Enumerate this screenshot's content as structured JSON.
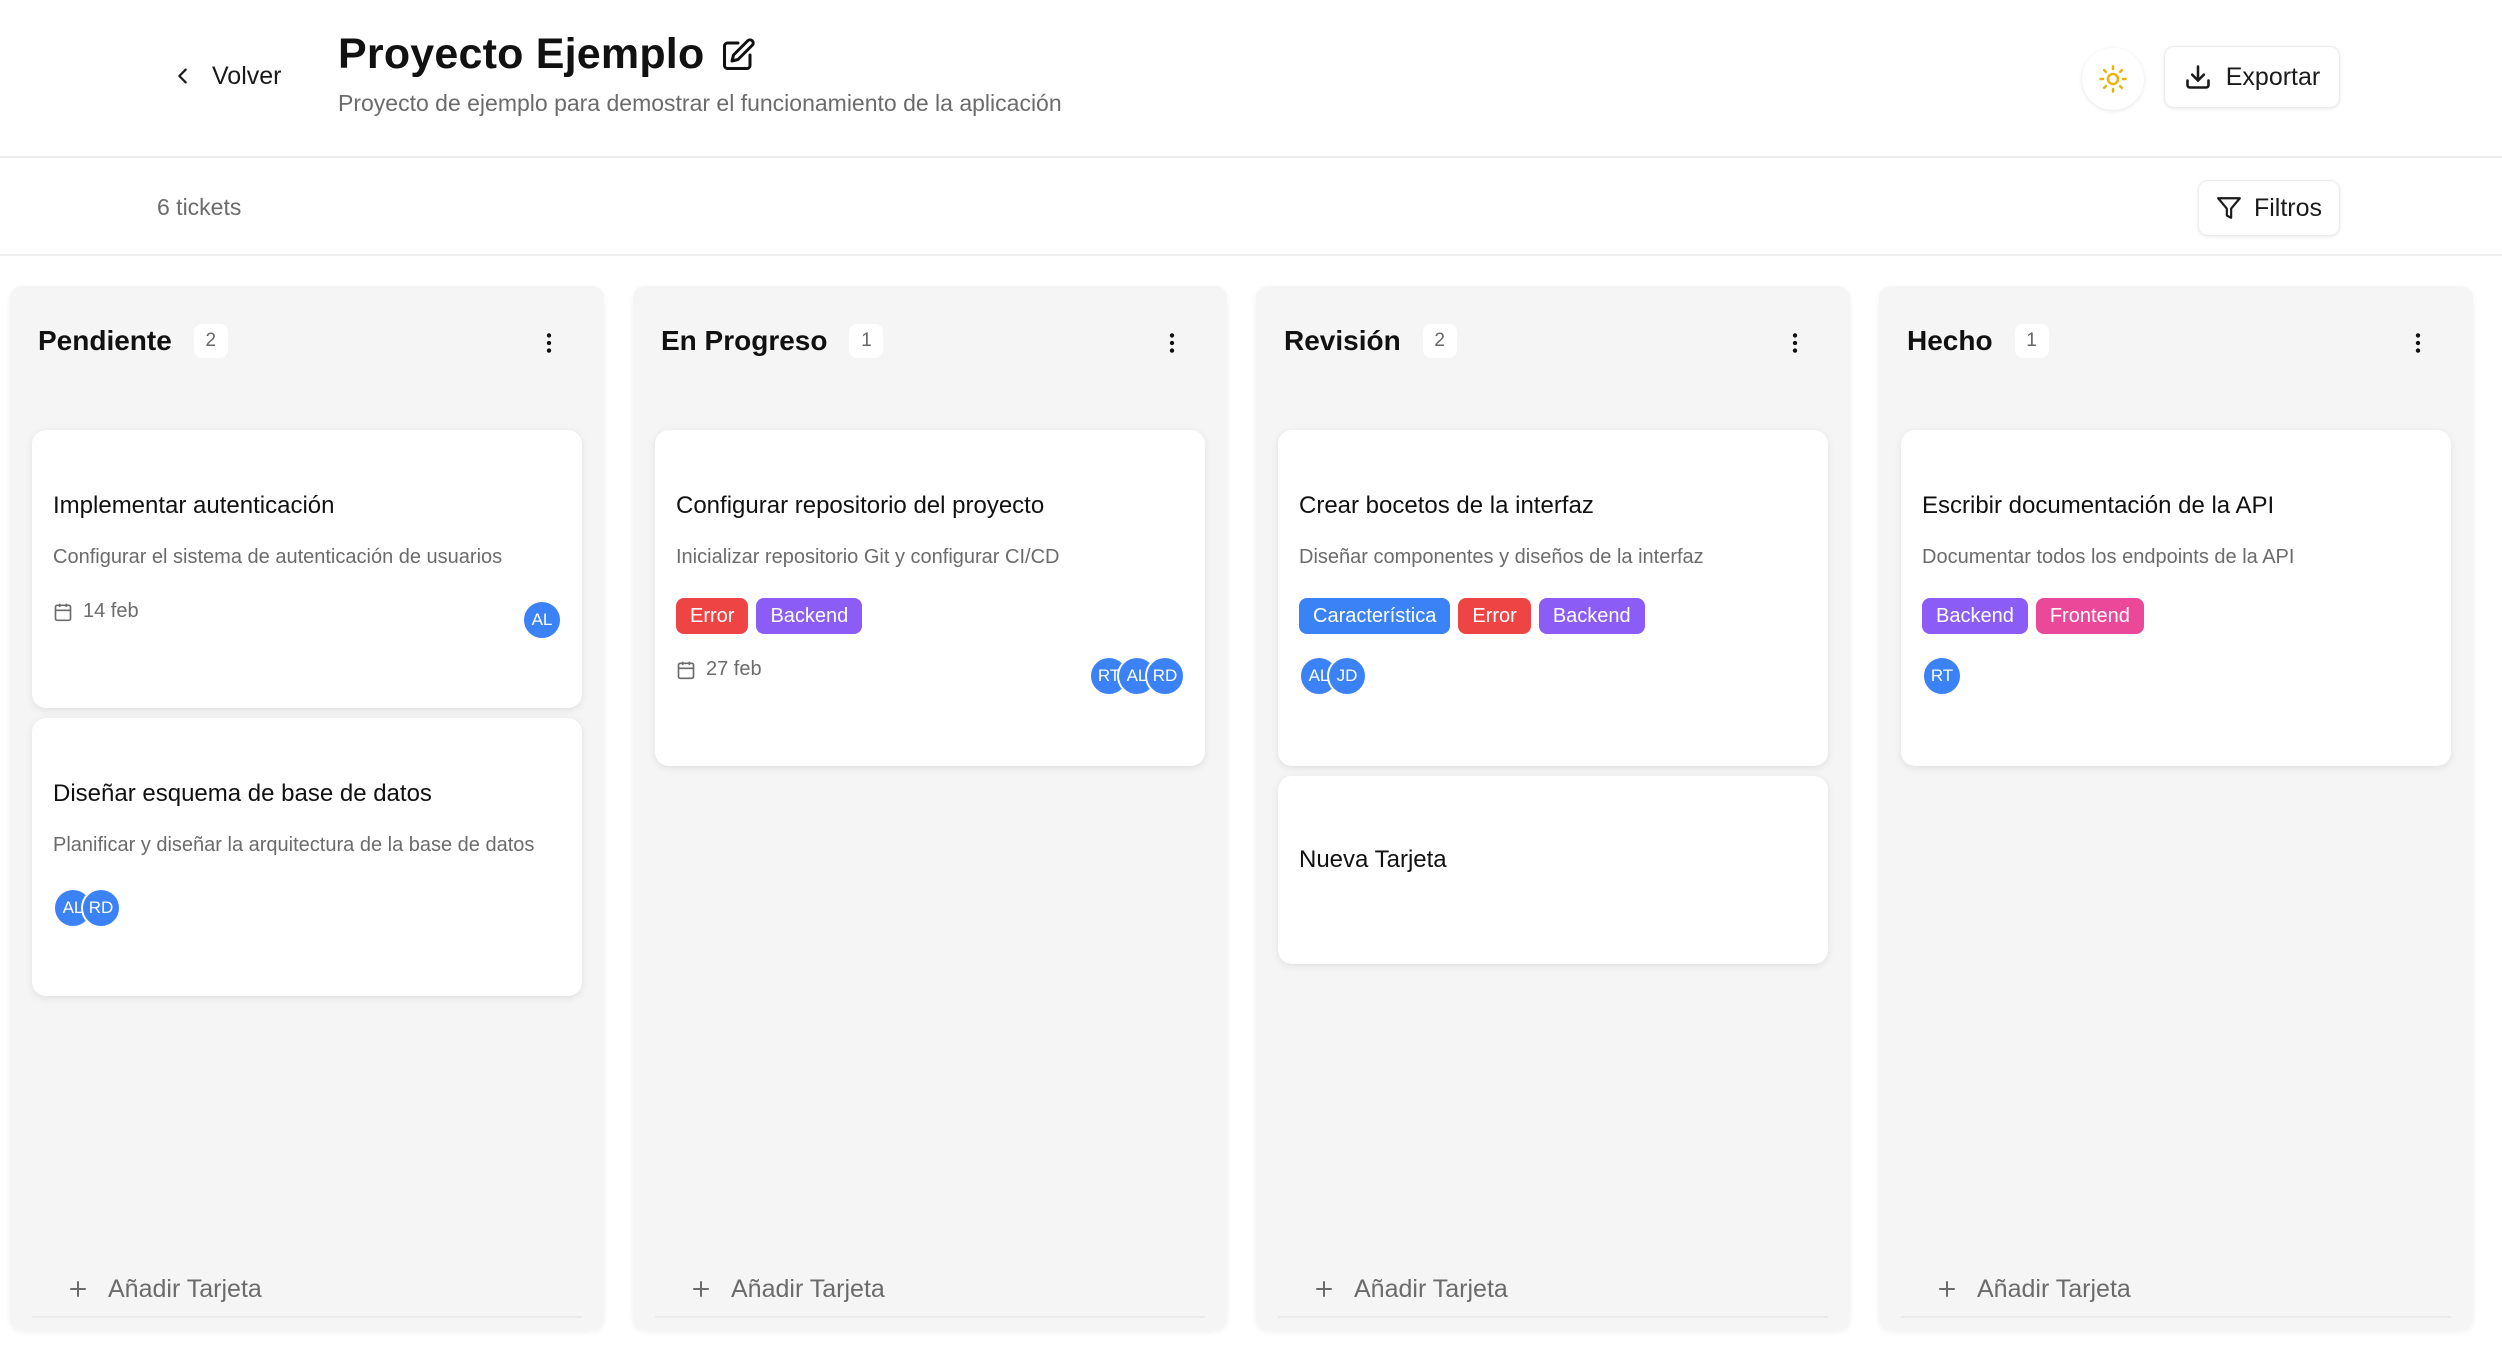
{
  "header": {
    "back_label": "Volver",
    "title": "Proyecto Ejemplo",
    "subtitle": "Proyecto de ejemplo para demostrar el funcionamiento de la aplicación",
    "export_label": "Exportar"
  },
  "toolbar": {
    "ticket_count": "6 tickets",
    "filter_label": "Filtros"
  },
  "colors": {
    "tag_error": "#ef4444",
    "tag_backend": "#8b5cf6",
    "tag_caracteristica": "#3b82f6",
    "tag_frontend": "#ec4899",
    "avatar": "#3b82f6",
    "sun_icon": "#eab308"
  },
  "columns": [
    {
      "title": "Pendiente",
      "count": "2",
      "add_label": "Añadir Tarjeta",
      "cards": [
        {
          "title": "Implementar autenticación",
          "description": "Configurar el sistema de autenticación de usuarios",
          "date": "14 feb",
          "avatars": [
            "AL"
          ]
        },
        {
          "title": "Diseñar esquema de base de datos",
          "description": "Planificar y diseñar la arquitectura de la base de datos",
          "avatars": [
            "AL",
            "RD"
          ]
        }
      ]
    },
    {
      "title": "En Progreso",
      "count": "1",
      "add_label": "Añadir Tarjeta",
      "cards": [
        {
          "title": "Configurar repositorio del proyecto",
          "description": "Inicializar repositorio Git y configurar CI/CD",
          "tags": [
            "Error",
            "Backend"
          ],
          "date": "27 feb",
          "avatars": [
            "RT",
            "AL",
            "RD"
          ]
        }
      ]
    },
    {
      "title": "Revisión",
      "count": "2",
      "add_label": "Añadir Tarjeta",
      "cards": [
        {
          "title": "Crear bocetos de la interfaz",
          "description": "Diseñar componentes y diseños de la interfaz",
          "tags": [
            "Característica",
            "Error",
            "Backend"
          ],
          "avatars": [
            "AL",
            "JD"
          ]
        },
        {
          "title": "Nueva Tarjeta"
        }
      ]
    },
    {
      "title": "Hecho",
      "count": "1",
      "add_label": "Añadir Tarjeta",
      "cards": [
        {
          "title": "Escribir documentación de la API",
          "description": "Documentar todos los endpoints de la API",
          "tags": [
            "Backend",
            "Frontend"
          ],
          "avatars": [
            "RT"
          ]
        }
      ]
    }
  ]
}
